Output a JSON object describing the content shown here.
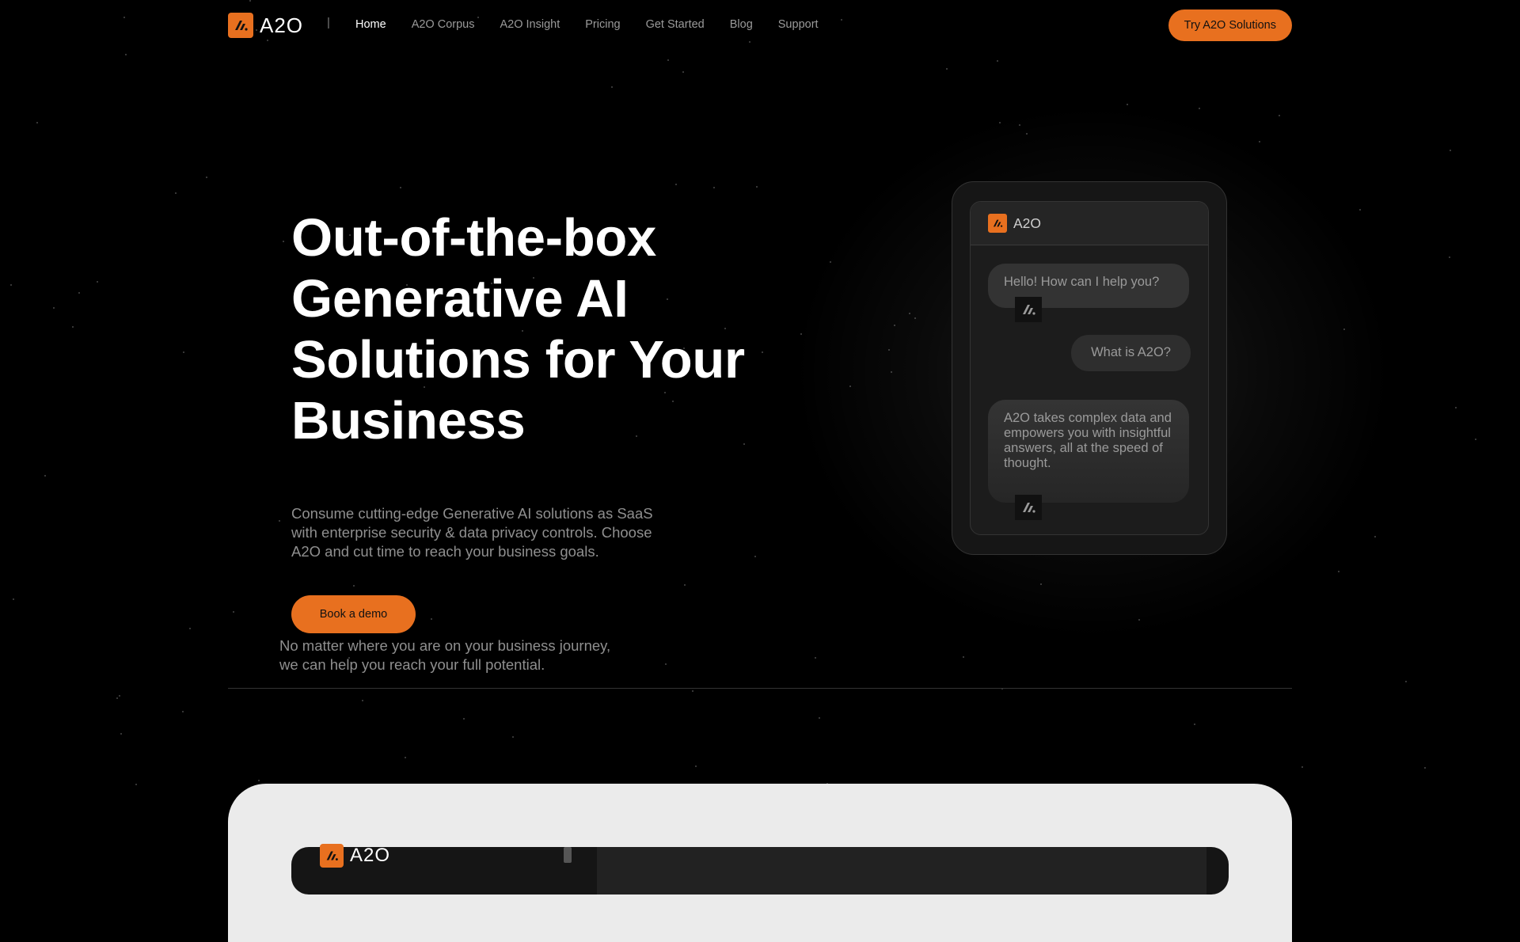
{
  "brand": {
    "name": "A2O",
    "accent": "#e8701f",
    "background": "#000000"
  },
  "nav": {
    "separator": "|",
    "links": [
      {
        "label": "Home",
        "active": true
      },
      {
        "label": "A2O Corpus",
        "active": false
      },
      {
        "label": "A2O Insight",
        "active": false
      },
      {
        "label": "Pricing",
        "active": false
      },
      {
        "label": "Get Started",
        "active": false
      },
      {
        "label": "Blog",
        "active": false
      },
      {
        "label": "Support",
        "active": false
      }
    ],
    "cta_label": "Try A2O Solutions"
  },
  "hero": {
    "title_lines": [
      "Out-of-the-box",
      "Generative AI",
      "Solutions for Your",
      "Business"
    ],
    "subtitle": "Consume cutting-edge Generative AI solutions as SaaS with enterprise security & data privacy controls. Choose A2O and cut time to reach your business goals.",
    "demo_label": "Book a demo",
    "note_lines": [
      "No matter where you are on your business journey,",
      "we can help you reach your full potential."
    ]
  },
  "chat": {
    "title": "A2O",
    "messages": [
      {
        "from": "bot",
        "text": "Hello! How can I help you?"
      },
      {
        "from": "user",
        "text": "What is A2O?"
      },
      {
        "from": "bot",
        "text": "A2O takes complex data and empowers you with insightful answers, all at the speed of thought."
      }
    ],
    "icons": {
      "logo": "a2o-logo-icon",
      "bot_avatar": "bot-avatar-icon"
    }
  },
  "preview": {
    "brand": "A2O"
  }
}
